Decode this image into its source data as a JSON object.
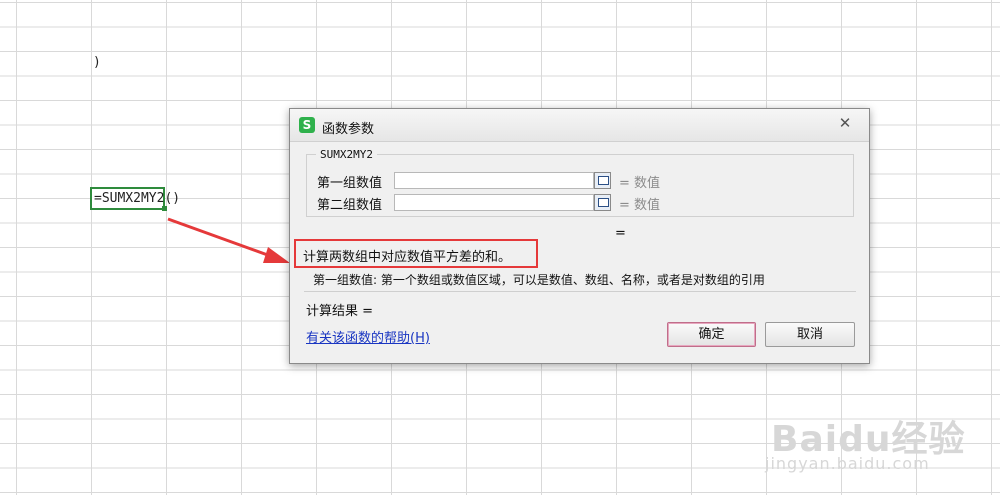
{
  "sheet": {
    "cell_paren": ")",
    "formula": "=SUMX2MY2()"
  },
  "dialog": {
    "title": "函数参数",
    "app_icon": "S",
    "close": "✕",
    "function_name": "SUMX2MY2",
    "args": [
      {
        "label": "第一组数值",
        "value": "",
        "hint": "= 数值"
      },
      {
        "label": "第二组数值",
        "value": "",
        "hint": "= 数值"
      }
    ],
    "result_eq": "=",
    "description": "计算两数组中对应数值平方差的和。",
    "arg_description": "第一组数值: 第一个数组或数值区域，可以是数值、数组、名称，或者是对数组的引用",
    "calc_result": "计算结果 =",
    "help_link": "有关该函数的帮助(H)",
    "ok_label": "确定",
    "cancel_label": "取消"
  },
  "watermark": {
    "main": "Baidu经验",
    "sub": "jingyan.baidu.com"
  },
  "colors": {
    "highlight": "#e5393a",
    "cell_border": "#2e8b3c",
    "app_icon": "#2fb14c"
  }
}
